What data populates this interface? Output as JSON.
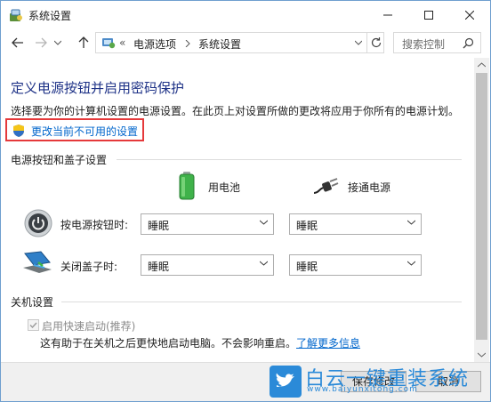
{
  "window": {
    "title": "系统设置"
  },
  "address": {
    "overflow": "«",
    "crumbs": [
      "电源选项",
      "系统设置"
    ],
    "search_placeholder": "搜索控制"
  },
  "page": {
    "heading": "定义电源按钮并启用密码保护",
    "description": "选择要为你的计算机设置的电源设置。在此页上对设置所做的更改将应用于你所有的电源计划。",
    "change_link": "更改当前不可用的设置"
  },
  "power_section": {
    "title": "电源按钮和盖子设置",
    "col_battery": "用电池",
    "col_plugged": "接通电源",
    "rows": [
      {
        "label": "按电源按钮时:",
        "battery": "睡眠",
        "plugged": "睡眠"
      },
      {
        "label": "关闭盖子时:",
        "battery": "睡眠",
        "plugged": "睡眠"
      }
    ]
  },
  "shutdown_section": {
    "title": "关机设置",
    "fast_startup_label": "启用快速启动(推荐)",
    "fast_startup_checked": true,
    "fast_startup_help": "这有助于在关机之后更快地启动电脑。不会影响重启。",
    "learn_more": "了解更多信息"
  },
  "footer": {
    "save_label": "保存修改",
    "cancel_label": "取消"
  },
  "watermark": {
    "brand": "白云一键重装系统",
    "url": "www.baiyunxitong.com"
  },
  "colors": {
    "heading": "#1e3287",
    "link": "#0066cc",
    "highlight_border": "#e5393b"
  }
}
